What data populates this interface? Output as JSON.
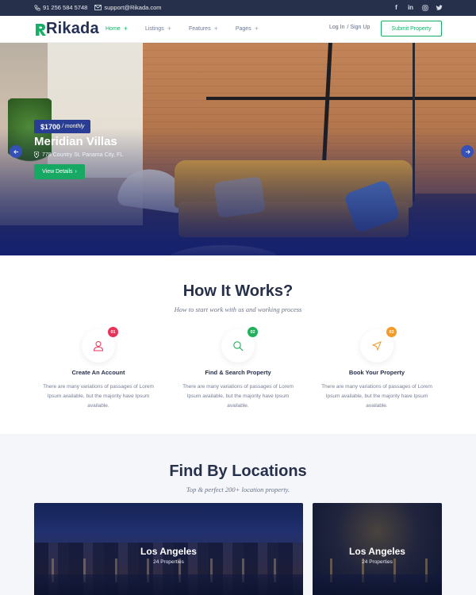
{
  "topbar": {
    "phone": "91 256 584 5748",
    "email": "support@Rikada.com",
    "socials": [
      "facebook-icon",
      "linkedin-icon",
      "instagram-icon",
      "twitter-icon"
    ]
  },
  "header": {
    "logo": "Rikada",
    "nav": [
      {
        "label": "Home",
        "active": true
      },
      {
        "label": "Listings",
        "active": false
      },
      {
        "label": "Features",
        "active": false
      },
      {
        "label": "Pages",
        "active": false
      }
    ],
    "login": "Log In",
    "signup": "/ Sign Up",
    "submit": "Submit Property"
  },
  "hero": {
    "price": "$1700",
    "period": "/ monthly",
    "title": "Meridian Villas",
    "address": "778 Country St. Panama City, FL",
    "cta": "View Details"
  },
  "how": {
    "title": "How It Works?",
    "subtitle": "How to start work with us and working process",
    "steps": [
      {
        "num": "01",
        "title": "Create An Account",
        "desc": "There are many variations of passages of Lorem Ipsum available, but the majority have Ipsum available.",
        "color": "#e8325a"
      },
      {
        "num": "02",
        "title": "Find & Search Property",
        "desc": "There are many variations of passages of Lorem Ipsum available, but the majority have Ipsum available.",
        "color": "#22b05c"
      },
      {
        "num": "03",
        "title": "Book Your Property",
        "desc": "There are many variations of passages of Lorem Ipsum available, but the majority have Ipsum available.",
        "color": "#f39a28"
      }
    ]
  },
  "locations": {
    "title": "Find By Locations",
    "subtitle": "Top & perfect 200+ location property.",
    "cards": [
      {
        "name": "Los Angeles",
        "count": "24 Properties"
      },
      {
        "name": "Los Angeles",
        "count": "24 Properties"
      }
    ]
  },
  "colors": {
    "brand": "#15b067",
    "dark": "#27304a",
    "hero_tag": "#2a3d94"
  }
}
